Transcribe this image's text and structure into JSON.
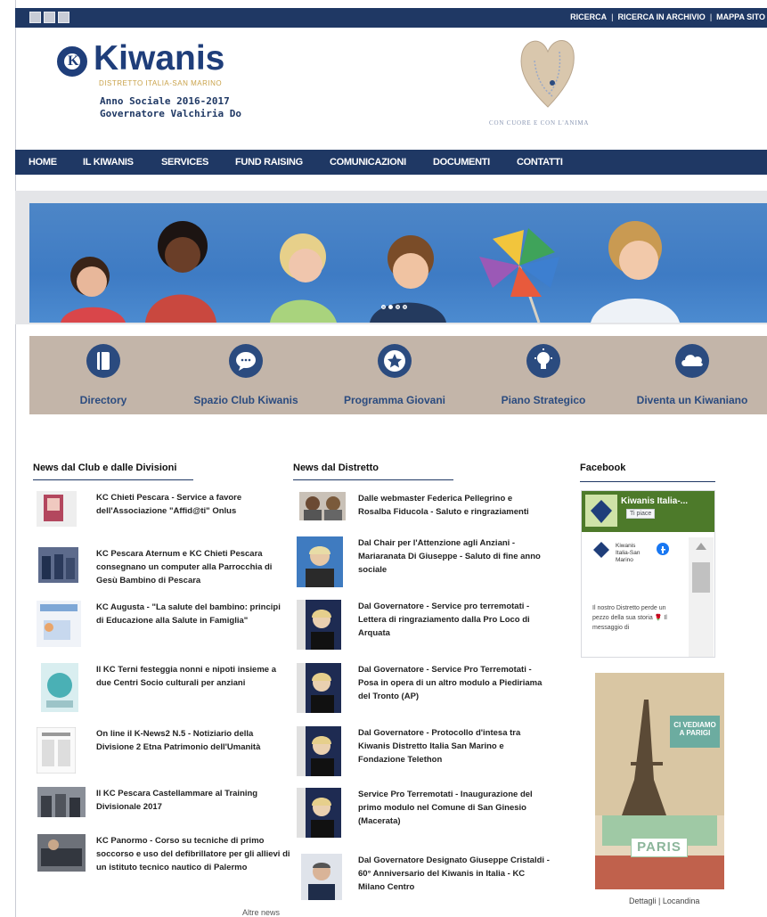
{
  "topbar": {
    "links": [
      "RICERCA",
      "RICERCA IN ARCHIVIO",
      "MAPPA SITO"
    ],
    "separator": "|"
  },
  "header": {
    "logo_letter": "K",
    "logo_text": "Kiwanis",
    "logo_subtitle": "DISTRETTO ITALIA-SAN MARINO",
    "anno": "Anno Sociale 2016-2017",
    "governatore": "Governatore Valchiria Do",
    "motto": "CON CUORE E CON L'ANIMA"
  },
  "nav": {
    "items": [
      "HOME",
      "IL KIWANIS",
      "SERVICES",
      "FUND RAISING",
      "COMUNICAZIONI",
      "DOCUMENTI",
      "CONTATTI"
    ]
  },
  "quick_links": [
    {
      "label": "Directory",
      "icon": "book-icon"
    },
    {
      "label": "Spazio Club Kiwanis",
      "icon": "chat-bubble-icon"
    },
    {
      "label": "Programma Giovani",
      "icon": "star-icon"
    },
    {
      "label": "Piano Strategico",
      "icon": "lightbulb-icon"
    },
    {
      "label": "Diventa un Kiwaniano",
      "icon": "cloud-icon"
    }
  ],
  "club_news": {
    "title": "News dal Club e dalle Divisioni",
    "items": [
      "KC Chieti Pescara - Service a favore dell'Associazione \"Affid@ti\" Onlus",
      "KC Pescara Aternum e KC Chieti Pescara consegnano un computer alla Parrocchia di Gesù Bambino di Pescara",
      "KC Augusta - \"La salute del bambino: principi di Educazione alla Salute in Famiglia\"",
      "Il KC Terni festeggia nonni e nipoti insieme a due Centri Socio culturali per anziani",
      "On line il K-News2 N.5 - Notiziario della Divisione 2 Etna Patrimonio dell'Umanità",
      "Il KC Pescara Castellammare al Training Divisionale 2017",
      "KC Panormo - Corso su tecniche di primo soccorso e uso del defibrillatore per gli allievi di un istituto tecnico nautico di Palermo"
    ],
    "more": "Altre news"
  },
  "district_news": {
    "title": "News dal Distretto",
    "items": [
      "Dalle webmaster Federica Pellegrino e Rosalba Fiducola - Saluto e ringraziamenti",
      "Dal Chair per l'Attenzione agli Anziani - Mariaranata Di Giuseppe - Saluto di fine anno sociale",
      "Dal Governatore - Service pro terremotati - Lettera di ringraziamento dalla Pro Loco di Arquata",
      "Dal Governatore - Service Pro Terremotati - Posa in opera di un altro modulo a Piediriama del Tronto (AP)",
      "Dal Governatore - Protocollo d'intesa tra Kiwanis Distretto Italia San Marino e Fondazione Telethon",
      "Service Pro Terremotati - Inaugurazione del primo modulo nel Comune di San Ginesio (Macerata)",
      "Dal Governatore Designato Giuseppe Cristaldi - 60° Anniversario del Kiwanis in Italia - KC Milano Centro"
    ]
  },
  "facebook": {
    "title": "Facebook",
    "page_title": "Kiwanis Italia-...",
    "like_label": "Ti piace",
    "post_name": "Kiwanis Italia-San Marino",
    "post_text": "Il nostro Distretto perde un pezzo della sua storia 🌹 Il messaggio di"
  },
  "poster": {
    "headline": "CI VEDIAMO A PARIGI",
    "city": "PARIS",
    "caption": "Dettagli | Locandina"
  },
  "colors": {
    "navy": "#1f3864",
    "tan": "#c3b5a9",
    "icon_blue": "#2b4b7f"
  }
}
